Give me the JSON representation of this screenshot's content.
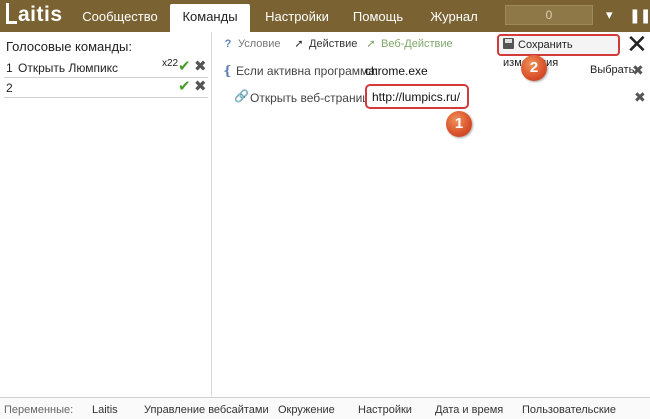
{
  "app": {
    "logo_text": "aitis",
    "counter": "0"
  },
  "nav": {
    "tabs": [
      {
        "label": "Сообщество"
      },
      {
        "label": "Команды"
      },
      {
        "label": "Настройки"
      },
      {
        "label": "Помощь"
      },
      {
        "label": "Журнал"
      }
    ],
    "active_tab": "Команды"
  },
  "sidebar": {
    "title": "Голосовые команды:",
    "commands": [
      {
        "num": "1",
        "text": "Открыть Люмпикс",
        "badge": "x22"
      },
      {
        "num": "2",
        "text": "",
        "badge": ""
      }
    ]
  },
  "toolbar": {
    "condition_label": "Условие",
    "action_label": "Действие",
    "web_action_label": "Веб-Действие",
    "save_label": "Сохранить изменения"
  },
  "condition": {
    "label": "Если активна программа:",
    "value": "chrome.exe",
    "choose_label": "Выбрать"
  },
  "web_action": {
    "label": "Открыть веб-страницу:",
    "url": "http://lumpics.ru/"
  },
  "callouts": [
    "1",
    "2"
  ],
  "bottom": {
    "label": "Переменные:",
    "items": [
      "Laitis",
      "Управление вебсайтами",
      "Окружение",
      "Настройки",
      "Дата и время",
      "Пользовательские"
    ]
  },
  "colors": {
    "topbar": "#7a6233",
    "highlight": "#d23b3b",
    "callout": "#d9502a",
    "check": "#4a9e2a"
  }
}
